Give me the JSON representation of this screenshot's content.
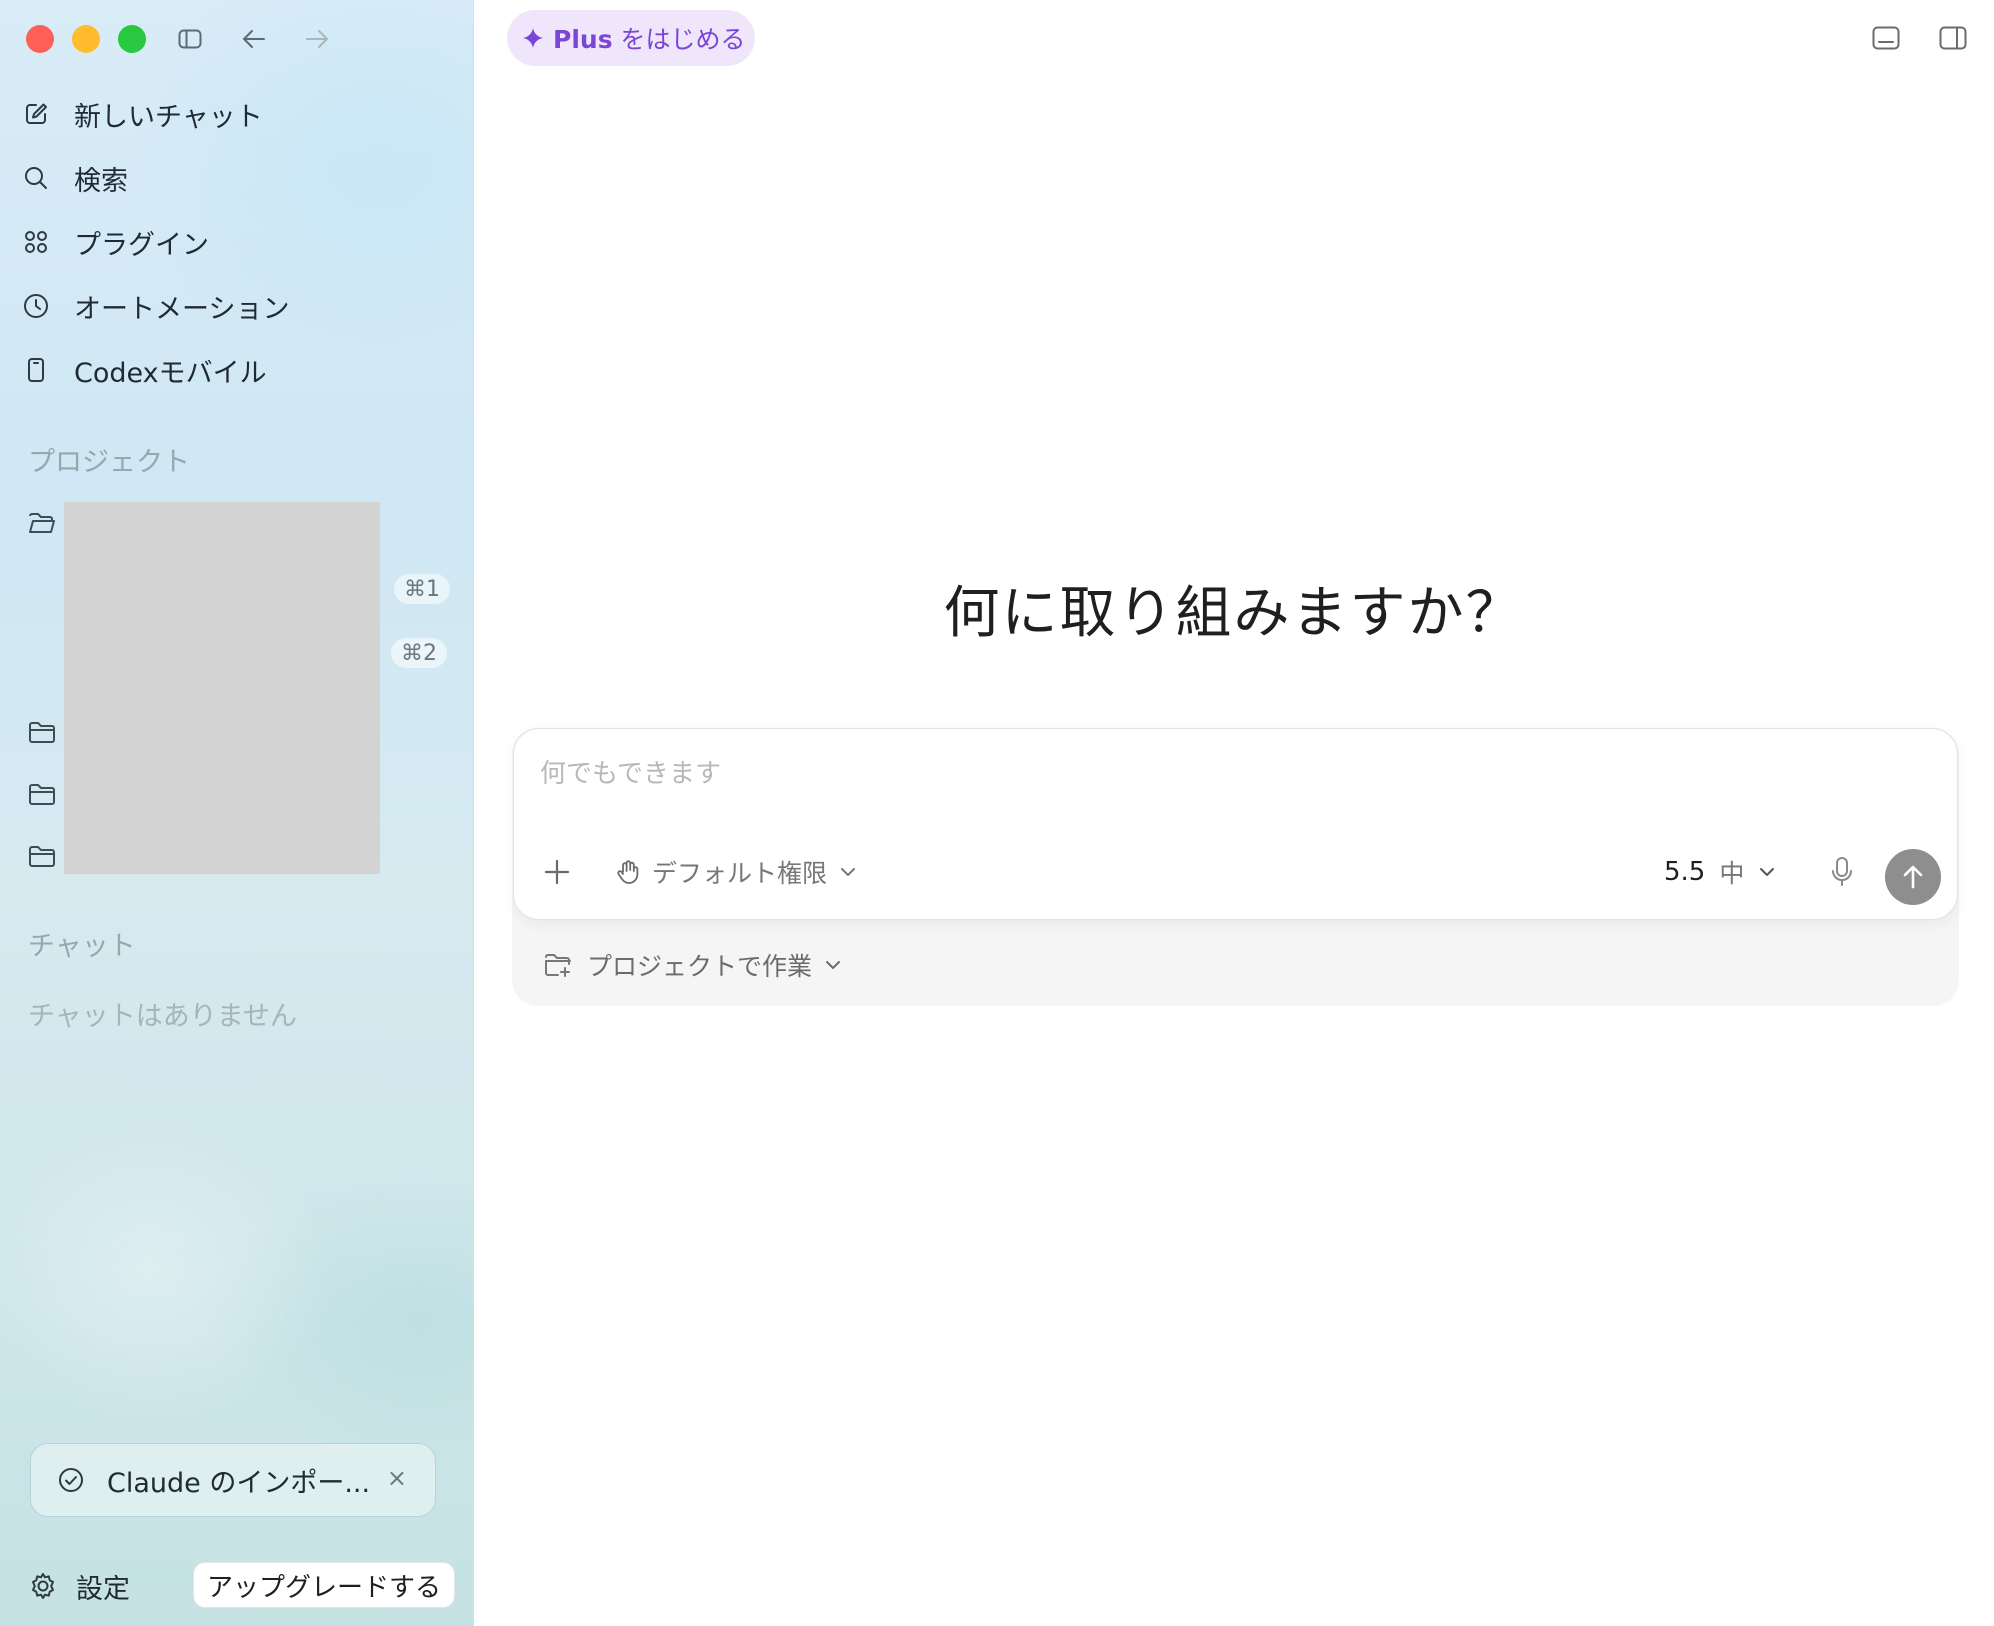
{
  "colors": {
    "accent_purple": "#7b45d8",
    "plus_pill_bg": "#efe6fb",
    "traffic_close": "#fe5f57",
    "traffic_minimize": "#febc2e",
    "traffic_zoom": "#28c840",
    "send_button": "#8e8e8e"
  },
  "sidebar": {
    "nav": [
      {
        "label": "新しいチャット",
        "icon": "edit-icon"
      },
      {
        "label": "検索",
        "icon": "search-icon"
      },
      {
        "label": "プラグイン",
        "icon": "grid-icon"
      },
      {
        "label": "オートメーション",
        "icon": "clock-icon"
      },
      {
        "label": "Codexモバイル",
        "icon": "phone-icon"
      }
    ],
    "projects_header": "プロジェクト",
    "shortcuts": [
      "⌘1",
      "⌘2"
    ],
    "chats_header": "チャット",
    "chats_empty": "チャットはありません",
    "toast": {
      "label": "Claude のインポー...",
      "close": "×"
    },
    "settings_label": "設定",
    "upgrade_label": "アップグレードする"
  },
  "header": {
    "plus_brand": "Plus",
    "plus_text": "をはじめる"
  },
  "main": {
    "heading": "何に取り組みますか？",
    "composer": {
      "placeholder": "何でもできます",
      "permission_label": "デフォルト権限",
      "model_version": "5.5",
      "effort": "中"
    },
    "project_label": "プロジェクトで作業"
  }
}
